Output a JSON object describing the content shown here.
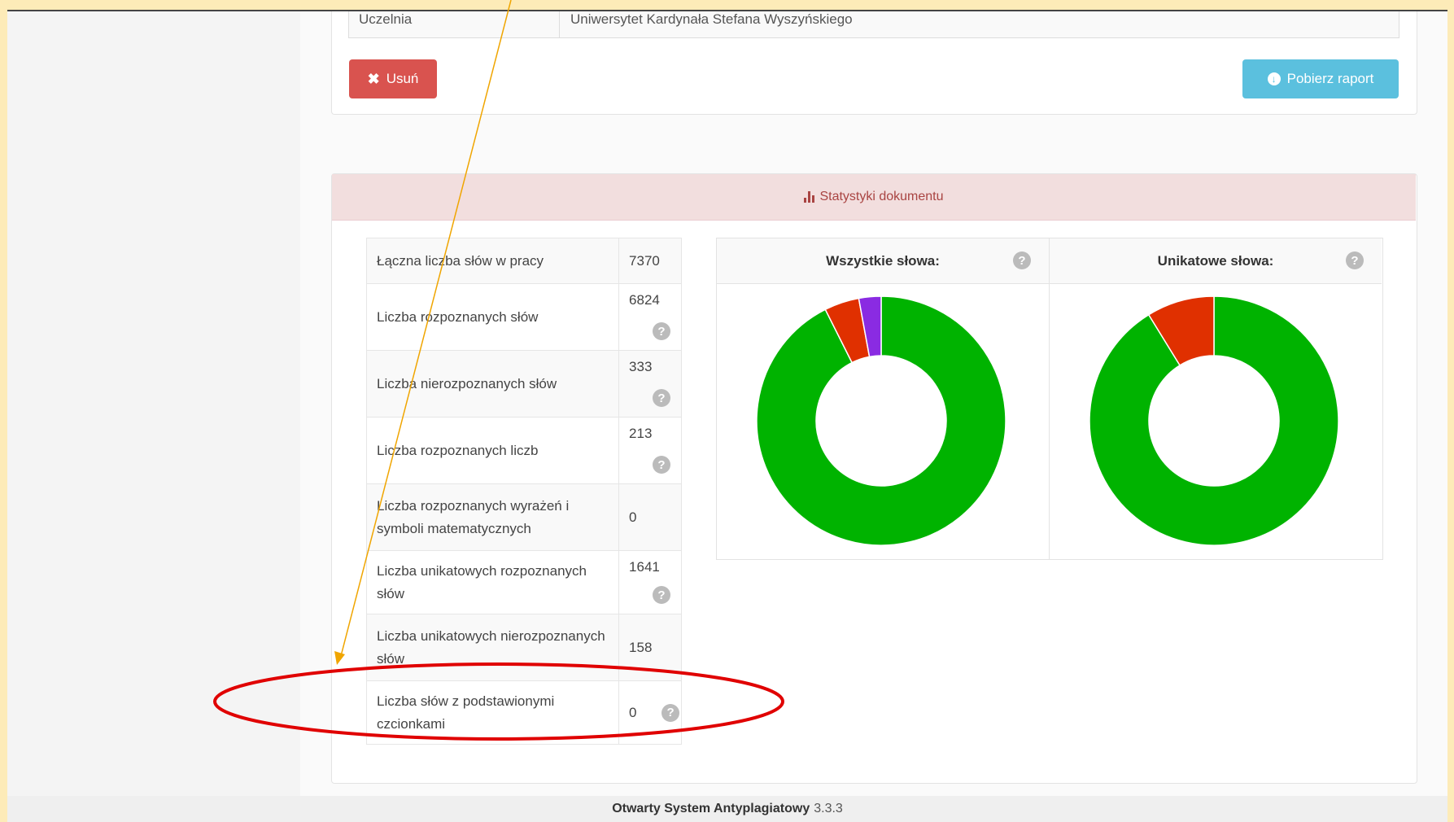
{
  "university": {
    "label": "Uczelnia",
    "value": "Uniwersytet Kardynała Stefana Wyszyńskiego"
  },
  "buttons": {
    "delete_label": "Usuń",
    "delete_icon": "close-icon",
    "report_label": "Pobierz raport",
    "report_icon": "download-icon"
  },
  "stats": {
    "title": "Statystyki dokumentu",
    "rows": [
      {
        "label": "Łączna liczba słów w pracy",
        "value": "7370",
        "help": false
      },
      {
        "label": "Liczba rozpoznanych słów",
        "value": "6824",
        "help": true
      },
      {
        "label": "Liczba nierozpoznanych słów",
        "value": "333",
        "help": true
      },
      {
        "label": "Liczba rozpoznanych liczb",
        "value": "213",
        "help": true
      },
      {
        "label": "Liczba rozpoznanych wyrażeń i symboli matematycznych",
        "value": "0",
        "help": false
      },
      {
        "label": "Liczba unikatowych rozpoznanych słów",
        "value": "1641",
        "help": true
      },
      {
        "label": "Liczba unikatowych nierozpoznanych słów",
        "value": "158",
        "help": false
      },
      {
        "label": "Liczba słów z podstawionymi czcionkami",
        "value": "0",
        "help": true
      }
    ]
  },
  "chart_data": [
    {
      "type": "pie",
      "title": "Wszystkie słowa:",
      "values": [
        6824,
        333,
        213
      ],
      "colors": [
        "#00b300",
        "#e03000",
        "#8a2be2"
      ],
      "donut": true
    },
    {
      "type": "pie",
      "title": "Unikatowe słowa:",
      "values": [
        1641,
        158
      ],
      "colors": [
        "#00b300",
        "#e03000"
      ],
      "donut": true
    }
  ],
  "help_glyph": "?",
  "footer": {
    "name": "Otwarty System Antyplagiatowy",
    "version": "3.3.3"
  },
  "annotation": {
    "arrow_color": "#f0a500",
    "ellipse_color": "#e00000"
  }
}
